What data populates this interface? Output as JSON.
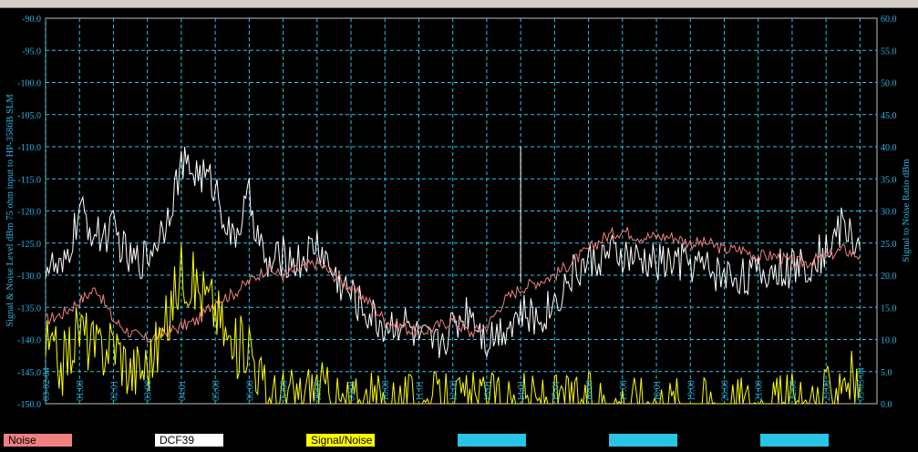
{
  "chart_data": {
    "type": "line",
    "title": "",
    "ylabel": "Signal & Noise Level dBm 75 ohm input to HP-3586B SLM",
    "y2label": "Signal to Noise Ratio dBm",
    "ylim": [
      -150,
      -90
    ],
    "y2lim": [
      0,
      60
    ],
    "yticks": [
      "-90.0",
      "-95.0",
      "-100.0",
      "-105.0",
      "-110.0",
      "-115.0",
      "-120.0",
      "-125.0",
      "-130.0",
      "-135.0",
      "-140.0",
      "-145.0",
      "-150.0"
    ],
    "y2ticks": [
      "60.0",
      "55.0",
      "50.0",
      "45.0",
      "40.0",
      "35.0",
      "30.0",
      "25.0",
      "20.0",
      "15.0",
      "10.0",
      "5.0",
      "0.0"
    ],
    "xlim": [
      0,
      24.5
    ],
    "xticks": [
      {
        "t": 0.0,
        "label": "03-02-04"
      },
      {
        "t": 1.0,
        "label": "01:00"
      },
      {
        "t": 2.0,
        "label": "02:01"
      },
      {
        "t": 3.0,
        "label": "03:00"
      },
      {
        "t": 4.0,
        "label": "04:01"
      },
      {
        "t": 5.0,
        "label": "05:00"
      },
      {
        "t": 6.0,
        "label": "06:00"
      },
      {
        "t": 7.0,
        "label": "07:00"
      },
      {
        "t": 8.0,
        "label": "08:00"
      },
      {
        "t": 9.0,
        "label": "09:01"
      },
      {
        "t": 10.0,
        "label": "10:00"
      },
      {
        "t": 11.0,
        "label": "11:01"
      },
      {
        "t": 12.0,
        "label": "12:00"
      },
      {
        "t": 13.0,
        "label": "13:01"
      },
      {
        "t": 14.0,
        "label": "14:01"
      },
      {
        "t": 15.0,
        "label": "15:01"
      },
      {
        "t": 16.0,
        "label": "16:00"
      },
      {
        "t": 17.0,
        "label": "17:00"
      },
      {
        "t": 18.0,
        "label": "18:01"
      },
      {
        "t": 19.0,
        "label": "19:00"
      },
      {
        "t": 20.0,
        "label": "20:00"
      },
      {
        "t": 21.0,
        "label": "21:00"
      },
      {
        "t": 22.0,
        "label": "22:00"
      },
      {
        "t": 23.0,
        "label": "23:00"
      },
      {
        "t": 24.0,
        "label": "03-03-04"
      }
    ],
    "series": [
      {
        "name": "Noise",
        "color": "#f08080",
        "axis": "left",
        "x": [
          0,
          0.5,
          1,
          1.5,
          2,
          2.5,
          3,
          3.5,
          4,
          4.5,
          5,
          5.5,
          6,
          6.5,
          7,
          7.5,
          8,
          8.5,
          9,
          9.5,
          10,
          10.5,
          11,
          11.5,
          12,
          12.5,
          13,
          13.5,
          14,
          14.5,
          15,
          15.5,
          16,
          16.5,
          17,
          17.5,
          18,
          18.5,
          19,
          19.5,
          20,
          20.5,
          21,
          21.5,
          22,
          22.5,
          23,
          23.5,
          24
        ],
        "y": [
          -137,
          -136,
          -134,
          -132,
          -137,
          -139,
          -140,
          -139,
          -138,
          -137,
          -134,
          -133,
          -131,
          -129,
          -130,
          -129,
          -128,
          -130,
          -132,
          -134,
          -137,
          -138,
          -139,
          -138,
          -137,
          -139,
          -138,
          -134,
          -132,
          -131,
          -130,
          -128,
          -126,
          -124,
          -123,
          -124,
          -124,
          -124,
          -125,
          -125,
          -126,
          -126,
          -127,
          -127,
          -128,
          -128,
          -127,
          -126,
          -127
        ]
      },
      {
        "name": "DCF39",
        "color": "#ffffff",
        "axis": "left",
        "x": [
          0,
          0.5,
          1,
          1.5,
          2,
          2.5,
          3,
          3.5,
          4,
          4.5,
          5,
          5.5,
          6,
          6.5,
          7,
          7.5,
          8,
          8.5,
          9,
          9.5,
          10,
          10.5,
          11,
          11.5,
          12,
          12.5,
          13,
          13.5,
          14,
          14.5,
          15,
          15.5,
          16,
          16.5,
          17,
          17.5,
          18,
          18.5,
          19,
          19.5,
          20,
          20.5,
          21,
          21.5,
          22,
          22.5,
          23,
          23.5,
          24
        ],
        "y": [
          -128,
          -130,
          -120,
          -124,
          -123,
          -128,
          -127,
          -122,
          -113,
          -114,
          -116,
          -125,
          -118,
          -129,
          -127,
          -128,
          -125,
          -130,
          -133,
          -136,
          -138,
          -137,
          -140,
          -141,
          -138,
          -135,
          -140,
          -138,
          -136,
          -137,
          -134,
          -130,
          -128,
          -127,
          -127,
          -128,
          -128,
          -128,
          -128,
          -129,
          -130,
          -130,
          -130,
          -129,
          -129,
          -128,
          -126,
          -122,
          -126
        ]
      },
      {
        "name": "Signal/Noise",
        "color": "#ffff00",
        "axis": "right",
        "x": [
          0,
          0.5,
          1,
          1.5,
          2,
          2.5,
          3,
          3.5,
          4,
          4.5,
          5,
          5.5,
          6,
          6.5,
          7,
          7.5,
          8,
          8.5,
          9,
          9.5,
          10,
          10.5,
          11,
          11.5,
          12,
          12.5,
          13,
          13.5,
          14,
          14.5,
          15,
          15.5,
          16,
          16.5,
          17,
          17.5,
          18,
          18.5,
          19,
          19.5,
          20,
          20.5,
          21,
          21.5,
          22,
          22.5,
          23,
          23.5,
          24
        ],
        "y": [
          9,
          6,
          12,
          8,
          10,
          5,
          6,
          11,
          21,
          18,
          15,
          8,
          10,
          1,
          1,
          1,
          3,
          0,
          0,
          0,
          0,
          0,
          0,
          0,
          0,
          0,
          0,
          0,
          0,
          0,
          0,
          0,
          0,
          0,
          0,
          0,
          0,
          0,
          0,
          0,
          0,
          0,
          0,
          0,
          0,
          0,
          1,
          5,
          3
        ]
      },
      {
        "name": "",
        "color": "#29c4e6",
        "axis": "none",
        "x": [],
        "y": []
      },
      {
        "name": "",
        "color": "#29c4e6",
        "axis": "none",
        "x": [],
        "y": []
      },
      {
        "name": "",
        "color": "#29c4e6",
        "axis": "none",
        "x": [],
        "y": []
      }
    ],
    "grid": true,
    "legend": "bottom"
  }
}
